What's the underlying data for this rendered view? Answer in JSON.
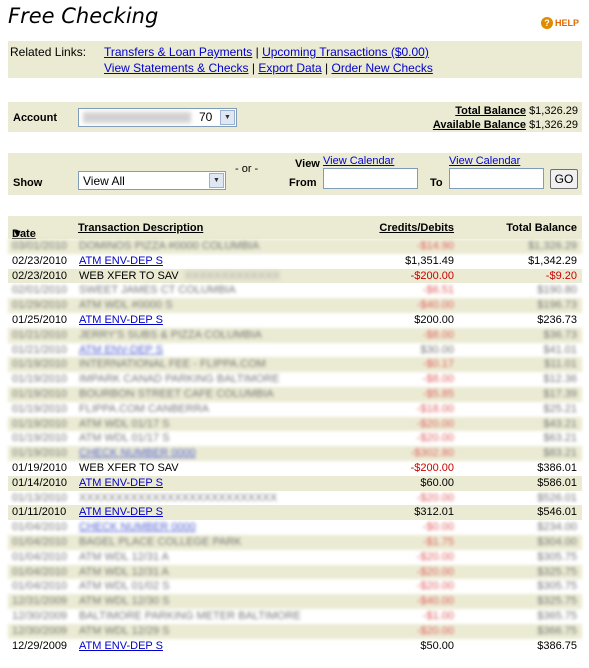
{
  "page": {
    "title": "Free Checking",
    "help_label": "HELP",
    "help_icon": "help-circle-icon"
  },
  "related_links": {
    "label": "Related Links:",
    "row1": [
      "Transfers & Loan Payments",
      "Upcoming Transactions ($0.00)"
    ],
    "row2": [
      "View Statements & Checks",
      "Export Data",
      "Order New Checks"
    ]
  },
  "account": {
    "label": "Account",
    "selected_suffix": "70",
    "total_balance_label": "Total Balance",
    "total_balance": "$1,326.29",
    "available_balance_label": "Available Balance",
    "available_balance": "$1,326.29"
  },
  "filter": {
    "show_label": "Show",
    "show_value": "View All",
    "or_text": "- or -",
    "view_label": "View",
    "from_label": "From",
    "to_label": "To",
    "view_calendar_label": "View Calendar",
    "go_label": "GO"
  },
  "table": {
    "headers": {
      "date": "Date",
      "description": "Transaction Description",
      "credits": "Credits/Debits",
      "total": "Total Balance"
    }
  },
  "transactions": [
    {
      "date": "03/01/2010",
      "desc": "DOMINOS PIZZA #0000 COLUMBIA",
      "amount": "-$14.90",
      "total": "$1,326.29",
      "blurred": true,
      "neg": true,
      "desc_link": false
    },
    {
      "date": "02/23/2010",
      "desc": "ATM ENV-DEP S",
      "amount": "$1,351.49",
      "total": "$1,342.29",
      "blurred": false,
      "neg": false,
      "desc_link": true
    },
    {
      "date": "02/23/2010",
      "desc": "WEB XFER TO SAV",
      "desc_extra": "XXXXXXXXXXXXX",
      "amount": "-$200.00",
      "total": "-$9.20",
      "blurred": false,
      "neg": true,
      "total_neg": true,
      "desc_link": false
    },
    {
      "date": "02/01/2010",
      "desc": "SWEET JAMES CT COLUMBIA",
      "amount": "-$6.51",
      "total": "$190.80",
      "blurred": true,
      "neg": true,
      "desc_link": false
    },
    {
      "date": "01/29/2010",
      "desc": "ATM WDL #0000 S",
      "amount": "-$40.00",
      "total": "$196.73",
      "blurred": true,
      "neg": true,
      "desc_link": false
    },
    {
      "date": "01/25/2010",
      "desc": "ATM ENV-DEP S",
      "amount": "$200.00",
      "total": "$236.73",
      "blurred": false,
      "neg": false,
      "desc_link": true
    },
    {
      "date": "01/21/2010",
      "desc": "JERRY'S SUBS & PIZZA COLUMBIA",
      "amount": "-$8.00",
      "total": "$36.73",
      "blurred": true,
      "neg": true,
      "desc_link": false
    },
    {
      "date": "01/21/2010",
      "desc": "ATM ENV-DEP S",
      "amount": "$30.00",
      "total": "$41.01",
      "blurred": true,
      "neg": false,
      "desc_link": true
    },
    {
      "date": "01/19/2010",
      "desc": "INTERNATIONAL FEE - FLIPPA.COM",
      "amount": "-$0.17",
      "total": "$11.01",
      "blurred": true,
      "neg": true,
      "desc_link": false
    },
    {
      "date": "01/19/2010",
      "desc": "IMPARK CANAD PARKING BALTIMORE",
      "amount": "-$8.00",
      "total": "$12.36",
      "blurred": true,
      "neg": true,
      "desc_link": false
    },
    {
      "date": "01/19/2010",
      "desc": "BOURBON STREET CAFE COLUMBIA",
      "amount": "-$5.85",
      "total": "$17.39",
      "blurred": true,
      "neg": true,
      "desc_link": false
    },
    {
      "date": "01/19/2010",
      "desc": "FLIPPA.COM CANBERRA",
      "amount": "-$18.00",
      "total": "$25.21",
      "blurred": true,
      "neg": true,
      "desc_link": false
    },
    {
      "date": "01/19/2010",
      "desc": "ATM WDL 01/17 S",
      "amount": "-$20.00",
      "total": "$43.21",
      "blurred": true,
      "neg": true,
      "desc_link": false
    },
    {
      "date": "01/19/2010",
      "desc": "ATM WDL 01/17 S",
      "amount": "-$20.00",
      "total": "$63.21",
      "blurred": true,
      "neg": true,
      "desc_link": false
    },
    {
      "date": "01/19/2010",
      "desc": "CHECK NUMBER 0000",
      "amount": "-$302.80",
      "total": "$83.21",
      "blurred": true,
      "neg": true,
      "desc_link": true
    },
    {
      "date": "01/19/2010",
      "desc": "WEB XFER TO SAV",
      "amount": "-$200.00",
      "total": "$386.01",
      "blurred": false,
      "neg": true,
      "desc_link": false
    },
    {
      "date": "01/14/2010",
      "desc": "ATM ENV-DEP S",
      "amount": "$60.00",
      "total": "$586.01",
      "blurred": false,
      "neg": false,
      "desc_link": true
    },
    {
      "date": "01/13/2010",
      "desc": "XXXXXXXXXXXXXXXXXXXXXXXXXXX",
      "amount": "-$20.00",
      "total": "$526.01",
      "blurred": true,
      "neg": true,
      "desc_link": false
    },
    {
      "date": "01/11/2010",
      "desc": "ATM ENV-DEP S",
      "amount": "$312.01",
      "total": "$546.01",
      "blurred": false,
      "neg": false,
      "desc_link": true
    },
    {
      "date": "01/04/2010",
      "desc": "CHECK NUMBER 0000",
      "amount": "-$0.00",
      "total": "$234.00",
      "blurred": true,
      "neg": true,
      "desc_link": true
    },
    {
      "date": "01/04/2010",
      "desc": "BAGEL PLACE COLLEGE PARK",
      "amount": "-$1.75",
      "total": "$304.00",
      "blurred": true,
      "neg": true,
      "desc_link": false
    },
    {
      "date": "01/04/2010",
      "desc": "ATM WDL 12/31 A",
      "amount": "-$20.00",
      "total": "$305.75",
      "blurred": true,
      "neg": true,
      "desc_link": false
    },
    {
      "date": "01/04/2010",
      "desc": "ATM WDL 12/31 A",
      "amount": "-$20.00",
      "total": "$325.75",
      "blurred": true,
      "neg": true,
      "desc_link": false
    },
    {
      "date": "01/04/2010",
      "desc": "ATM WDL 01/02 S",
      "amount": "-$20.00",
      "total": "$305.75",
      "blurred": true,
      "neg": true,
      "desc_link": false
    },
    {
      "date": "12/31/2009",
      "desc": "ATM WDL 12/30 S",
      "amount": "-$40.00",
      "total": "$325.75",
      "blurred": true,
      "neg": true,
      "desc_link": false
    },
    {
      "date": "12/30/2009",
      "desc": "BALTIMORE PARKING METER BALTIMORE",
      "amount": "-$1.00",
      "total": "$365.75",
      "blurred": true,
      "neg": true,
      "desc_link": false
    },
    {
      "date": "12/30/2009",
      "desc": "ATM WDL 12/29 S",
      "amount": "-$20.00",
      "total": "$366.75",
      "blurred": true,
      "neg": true,
      "desc_link": false
    },
    {
      "date": "12/29/2009",
      "desc": "ATM ENV-DEP S",
      "amount": "$50.00",
      "total": "$386.75",
      "blurred": false,
      "neg": false,
      "desc_link": true
    }
  ]
}
